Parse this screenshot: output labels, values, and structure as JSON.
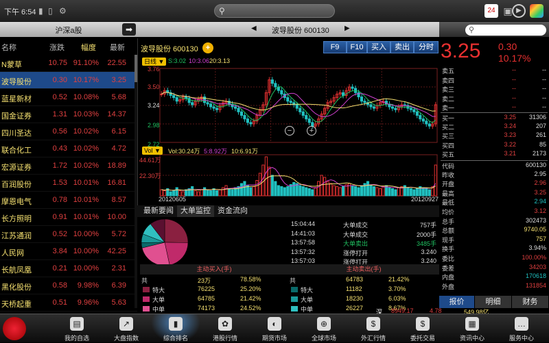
{
  "status": {
    "time": "下午 6:54"
  },
  "left": {
    "title": "沪深a股",
    "headers": [
      "名称",
      "涨跌",
      "幅度",
      "最新"
    ],
    "rows": [
      {
        "name": "N蒙草",
        "chg": "10.75",
        "pct": "91.10%",
        "last": "22.55"
      },
      {
        "name": "波导股份",
        "chg": "0.30",
        "pct": "10.17%",
        "last": "3.25",
        "selected": true
      },
      {
        "name": "蓝星新材",
        "chg": "0.52",
        "pct": "10.08%",
        "last": "5.68"
      },
      {
        "name": "国金证券",
        "chg": "1.31",
        "pct": "10.03%",
        "last": "14.37"
      },
      {
        "name": "四川圣达",
        "chg": "0.56",
        "pct": "10.02%",
        "last": "6.15"
      },
      {
        "name": "联合化工",
        "chg": "0.43",
        "pct": "10.02%",
        "last": "4.72"
      },
      {
        "name": "宏源证券",
        "chg": "1.72",
        "pct": "10.02%",
        "last": "18.89"
      },
      {
        "name": "百润股份",
        "chg": "1.53",
        "pct": "10.01%",
        "last": "16.81"
      },
      {
        "name": "摩恩电气",
        "chg": "0.78",
        "pct": "10.01%",
        "last": "8.57"
      },
      {
        "name": "长方照明",
        "chg": "0.91",
        "pct": "10.01%",
        "last": "10.00"
      },
      {
        "name": "江苏通润",
        "chg": "0.52",
        "pct": "10.00%",
        "last": "5.72"
      },
      {
        "name": "人民网",
        "chg": "3.84",
        "pct": "10.00%",
        "last": "42.25"
      },
      {
        "name": "长航凤凰",
        "chg": "0.21",
        "pct": "10.00%",
        "last": "2.31"
      },
      {
        "name": "黑化股份",
        "chg": "0.58",
        "pct": "9.98%",
        "last": "6.39"
      },
      {
        "name": "天桥起重",
        "chg": "0.51",
        "pct": "9.96%",
        "last": "5.63"
      }
    ]
  },
  "center": {
    "title": "波导股份 600130",
    "stock_label": "波导股份  600130",
    "buttons": [
      "F9",
      "F10",
      "买入",
      "卖出",
      "分时"
    ],
    "kline_tag": "日线 ▼",
    "ma": {
      "s": "S:3.02",
      "m": "10:3.06",
      "l": "20:3.13"
    },
    "price_ticks": [
      "3.76",
      "3.50",
      "3.24",
      "2.98",
      "2.72"
    ],
    "vol_tag": "Vol ▼",
    "vol_legend": {
      "v": "Vol:30.24万",
      "s": "5:8.92万",
      "l": "10:6.91万"
    },
    "vol_ticks": [
      "44.61万",
      "22.30万"
    ],
    "date_start": "20120605",
    "date_end": "20120927",
    "tabs": [
      "最新要闻",
      "大单监控",
      "资金流向"
    ],
    "trades": [
      {
        "time": "15:04:44",
        "type": "大单成交",
        "vol": "757手",
        "price": ""
      },
      {
        "time": "14:41:03",
        "type": "大单成交",
        "vol": "2000手",
        "price": ""
      },
      {
        "time": "13:57:58",
        "type": "大单卖出",
        "vol": "3485手",
        "price": ""
      },
      {
        "time": "13:57:32",
        "type": "涨停打开",
        "vol": "",
        "price": "3.240"
      },
      {
        "time": "13:57:03",
        "type": "涨停打开",
        "vol": "",
        "price": "3.240"
      }
    ],
    "flow_in_title": "主动买入(手)",
    "flow_out_title": "主动卖出(手)",
    "flow_in": [
      {
        "k": "共",
        "v": "23万",
        "p": "78.58%"
      },
      {
        "k": "特大",
        "v": "76225",
        "p": "25.20%"
      },
      {
        "k": "大单",
        "v": "64785",
        "p": "21.42%"
      },
      {
        "k": "中单",
        "v": "74173",
        "p": "24.52%"
      }
    ],
    "flow_out": [
      {
        "k": "共",
        "v": "64783",
        "p": "21.42%"
      },
      {
        "k": "特大",
        "v": "11182",
        "p": "3.70%"
      },
      {
        "k": "大单",
        "v": "18230",
        "p": "6.03%"
      },
      {
        "k": "中单",
        "v": "26227",
        "p": "8.67%"
      }
    ],
    "pie": [
      {
        "pct": 25.2,
        "color": "#8a2040"
      },
      {
        "pct": 21.42,
        "color": "#c02a6a"
      },
      {
        "pct": 24.52,
        "color": "#e05090"
      },
      {
        "pct": 3.7,
        "color": "#0a6a6a"
      },
      {
        "pct": 6.03,
        "color": "#1a9a9a"
      },
      {
        "pct": 8.67,
        "color": "#30c0c0"
      },
      {
        "pct": 10.46,
        "color": "#5a1030"
      }
    ]
  },
  "right": {
    "price": "3.25",
    "chg": "0.30",
    "pct": "10.17%",
    "book": [
      {
        "k": "卖五",
        "p": "--",
        "v": "--"
      },
      {
        "k": "卖四",
        "p": "--",
        "v": "--"
      },
      {
        "k": "卖三",
        "p": "--",
        "v": "--"
      },
      {
        "k": "卖二",
        "p": "--",
        "v": "--"
      },
      {
        "k": "卖一",
        "p": "--",
        "v": "--"
      },
      {
        "k": "买一",
        "p": "3.25",
        "v": "31306"
      },
      {
        "k": "买二",
        "p": "3.24",
        "v": "207"
      },
      {
        "k": "买三",
        "p": "3.23",
        "v": "261"
      },
      {
        "k": "买四",
        "p": "3.22",
        "v": "85"
      },
      {
        "k": "买五",
        "p": "3.21",
        "v": "2173"
      }
    ],
    "info": [
      {
        "k": "代码",
        "v": "600130",
        "c": "#ddd"
      },
      {
        "k": "昨收",
        "v": "2.95",
        "c": "#ddd"
      },
      {
        "k": "开盘",
        "v": "2.96",
        "c": "#e04040"
      },
      {
        "k": "最高",
        "v": "3.25",
        "c": "#e04040"
      },
      {
        "k": "最低",
        "v": "2.94",
        "c": "#20c0c0"
      },
      {
        "k": "均价",
        "v": "3.12",
        "c": "#e04040"
      },
      {
        "k": "总手",
        "v": "302473",
        "c": "#ddd"
      },
      {
        "k": "总额",
        "v": "9740.05",
        "c": "#f5e070"
      },
      {
        "k": "现手",
        "v": "757",
        "c": "#f5e070"
      },
      {
        "k": "换手",
        "v": "3.94%",
        "c": "#ddd"
      },
      {
        "k": "委比",
        "v": "100.00%",
        "c": "#e04040"
      },
      {
        "k": "委差",
        "v": "34203",
        "c": "#e04040"
      },
      {
        "k": "内盘",
        "v": "170618",
        "c": "#20c0c0"
      },
      {
        "k": "外盘",
        "v": "131854",
        "c": "#e04040"
      }
    ],
    "tabs": [
      "报价",
      "明细",
      "财务"
    ]
  },
  "ticker": {
    "mkt": "深",
    "a": "8949.17",
    "b": "4.78",
    "c": "549.98亿"
  },
  "dock": [
    "我的自选",
    "大盘指数",
    "综合排名",
    "港股行情",
    "期货市场",
    "全球市场",
    "外汇行情",
    "委托交易",
    "资讯中心",
    "服务中心"
  ],
  "kline": {
    "closes": [
      3.4,
      3.45,
      3.42,
      3.38,
      3.35,
      3.3,
      3.32,
      3.36,
      3.34,
      3.28,
      3.25,
      3.3,
      3.33,
      3.36,
      3.28,
      3.26,
      3.22,
      3.2,
      3.18,
      3.24,
      3.28,
      3.3,
      3.26,
      3.22,
      3.2,
      3.15,
      3.1,
      3.05,
      3.0,
      2.98,
      3.02,
      3.1,
      3.18,
      3.25,
      3.42,
      3.6,
      3.55,
      3.5,
      3.45,
      3.4,
      3.35,
      3.3,
      3.28,
      3.25,
      3.2,
      3.15,
      3.1,
      3.05,
      3.0,
      2.95,
      2.98,
      3.05,
      3.12,
      3.2,
      3.28,
      3.3,
      3.35,
      3.4,
      3.42,
      3.38,
      3.45,
      3.5,
      3.48,
      3.42,
      3.36,
      3.3,
      3.28,
      3.25,
      3.22,
      3.2,
      3.24,
      3.28,
      3.3,
      3.26,
      3.22,
      3.2,
      3.18,
      3.22,
      3.25,
      3.24,
      3.2,
      3.18,
      3.15,
      3.1,
      3.05,
      3.02,
      2.98,
      2.95,
      2.98,
      3.25
    ],
    "vols": [
      6,
      5,
      7,
      4,
      5,
      8,
      5,
      4,
      6,
      7,
      9,
      5,
      4,
      6,
      8,
      6,
      5,
      7,
      5,
      6,
      8,
      10,
      7,
      6,
      8,
      9,
      12,
      14,
      10,
      8,
      9,
      15,
      22,
      30,
      38,
      28,
      20,
      14,
      10,
      9,
      8,
      9,
      11,
      13,
      12,
      10,
      9,
      8,
      7,
      6,
      8,
      14,
      20,
      18,
      14,
      12,
      10,
      9,
      8,
      9,
      11,
      12,
      10,
      9,
      8,
      10,
      12,
      14,
      10,
      9,
      8,
      7,
      9,
      10,
      8,
      7,
      6,
      8,
      9,
      10,
      8,
      7,
      6,
      7,
      9,
      8,
      7,
      6,
      9,
      30
    ]
  }
}
